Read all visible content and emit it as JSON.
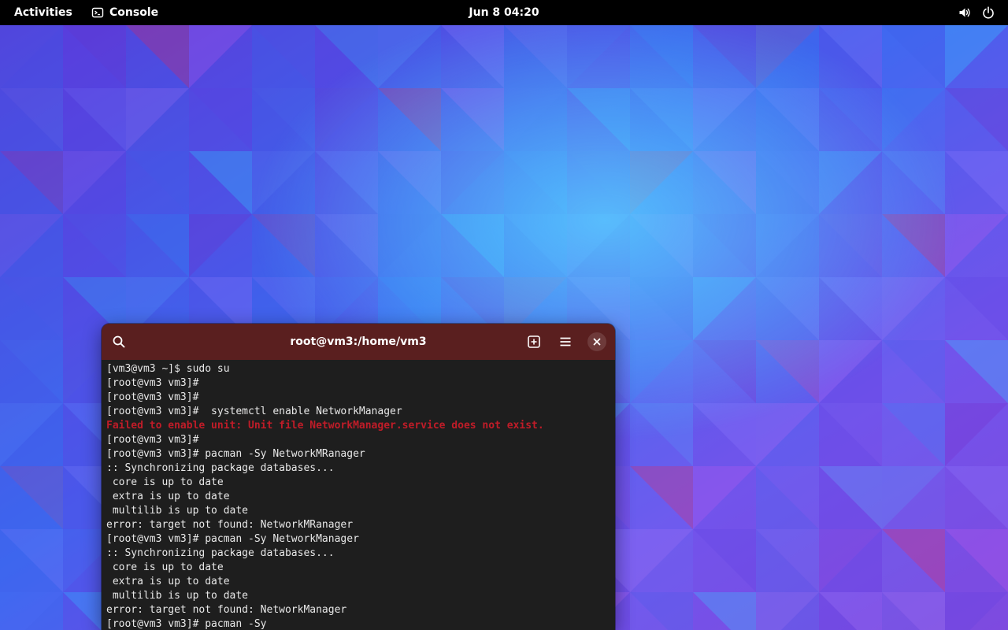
{
  "topbar": {
    "activities": "Activities",
    "app_name": "Console",
    "clock": "Jun 8  04:20",
    "icons": [
      "terminal-icon",
      "volume-icon",
      "power-icon"
    ]
  },
  "terminal": {
    "title": "root@vm3:/home/vm3",
    "icons": [
      "search-icon",
      "new-tab-icon",
      "hamburger-menu-icon",
      "close-icon"
    ],
    "header_color": "#5a1f1f",
    "background_color": "#1e1e1e",
    "error_color": "#c01c28",
    "lines": [
      {
        "text": "[vm3@vm3 ~]$ sudo su",
        "error": false
      },
      {
        "text": "[root@vm3 vm3]#",
        "error": false
      },
      {
        "text": "[root@vm3 vm3]#",
        "error": false
      },
      {
        "text": "[root@vm3 vm3]#  systemctl enable NetworkManager",
        "error": false
      },
      {
        "text": "Failed to enable unit: Unit file NetworkManager.service does not exist.",
        "error": true
      },
      {
        "text": "[root@vm3 vm3]#",
        "error": false
      },
      {
        "text": "[root@vm3 vm3]# pacman -Sy NetworkMRanager",
        "error": false
      },
      {
        "text": ":: Synchronizing package databases...",
        "error": false
      },
      {
        "text": " core is up to date",
        "error": false
      },
      {
        "text": " extra is up to date",
        "error": false
      },
      {
        "text": " multilib is up to date",
        "error": false
      },
      {
        "text": "error: target not found: NetworkMRanager",
        "error": false
      },
      {
        "text": "[root@vm3 vm3]# pacman -Sy NetworkManager",
        "error": false
      },
      {
        "text": ":: Synchronizing package databases...",
        "error": false
      },
      {
        "text": " core is up to date",
        "error": false
      },
      {
        "text": " extra is up to date",
        "error": false
      },
      {
        "text": " multilib is up to date",
        "error": false
      },
      {
        "text": "error: target not found: NetworkManager",
        "error": false
      },
      {
        "text": "[root@vm3 vm3]# pacman -Sy",
        "error": false
      }
    ]
  }
}
